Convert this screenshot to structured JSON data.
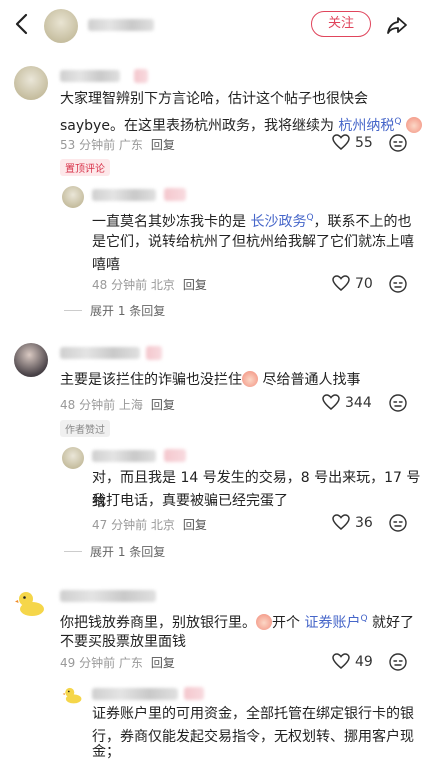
{
  "header": {
    "follow_label": "关注"
  },
  "comments": [
    {
      "text1": "大家理智辨别下方言论哈，估计这个帖子也很快会",
      "text2a": "saybye。在这里表扬杭州政务，我将继续为 ",
      "text2link": "杭州纳税",
      "time": "53 分钟前 广东",
      "reply": "回复",
      "likes": "55",
      "badge": "置顶评论",
      "sub": {
        "text1a": "一直莫名其妙冻我卡的是 ",
        "text1link": "长沙政务",
        "text1b": "，联系不上的也",
        "text2": "是它们，说转给杭州了但杭州给我解了它们就冻上嘻",
        "text3": "嘻嘻",
        "time": "48 分钟前 北京",
        "reply": "回复",
        "likes": "70"
      },
      "expand": "展开 1 条回复"
    },
    {
      "text1a": "主要是该拦住的诈骗也没拦住",
      "text1b": " 尽给普通人找事",
      "time": "48 分钟前 上海",
      "reply": "回复",
      "likes": "344",
      "badge": "作者赞过",
      "sub": {
        "text1": "对，而且我是 14 号发生的交易，8 号出来玩，17 号给",
        "text2": "我打电话，真要被骗已经完蛋了",
        "time": "47 分钟前 北京",
        "reply": "回复",
        "likes": "36"
      },
      "expand": "展开 1 条回复"
    },
    {
      "text1a": "你把钱放券商里，别放银行里。",
      "text1b": "开个 ",
      "text1link": "证券账户",
      "text1c": " 就好了",
      "text2": "不要买股票放里面钱",
      "time": "49 分钟前 广东",
      "reply": "回复",
      "likes": "49",
      "sub": {
        "text1": "证券账户里的可用资金，全部托管在绑定银行卡的银",
        "text2": "行，券商仅能发起交易指令，无权划转、挪用客户现",
        "text3": "金；"
      }
    }
  ]
}
